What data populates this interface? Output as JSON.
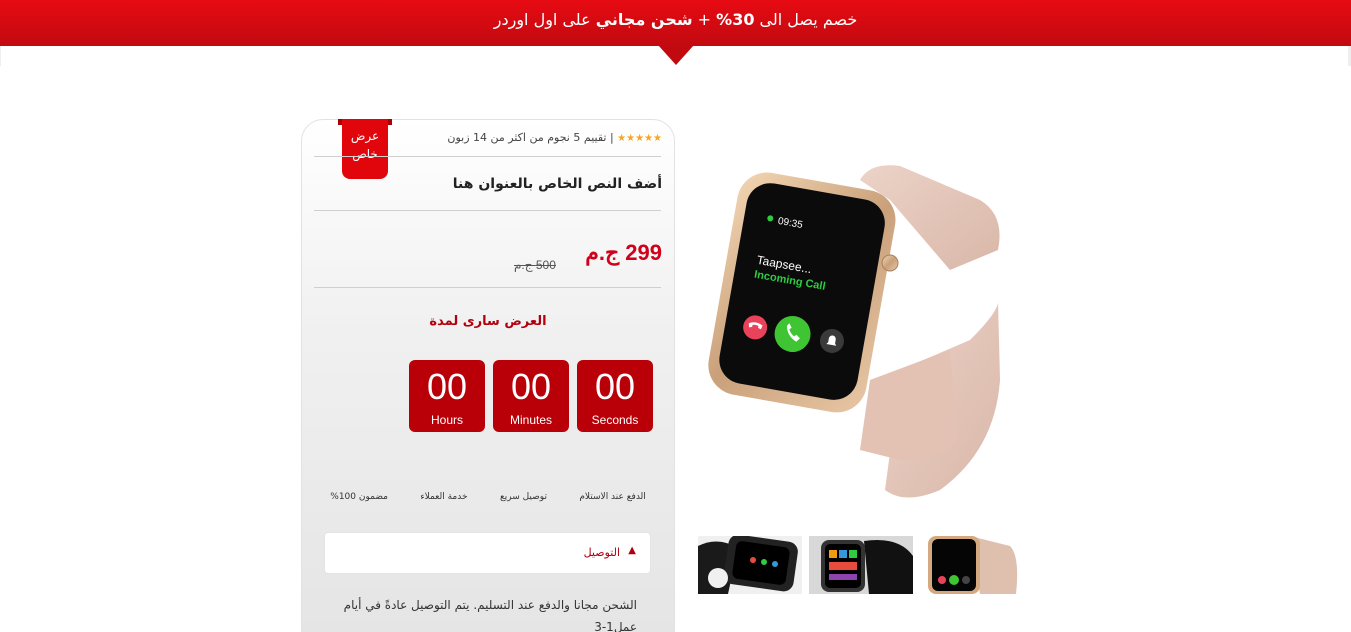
{
  "banner": {
    "text_part1": "خصم يصل الى ",
    "discount": "30%",
    "text_plus": " + ",
    "shipping": "شحن مجاني",
    "text_part2": " على اول اوردر"
  },
  "product": {
    "badge_line1": "عرض",
    "badge_line2": "خاص",
    "stars": "★★★★★",
    "rating_text": "| تقييم 5 نجوم من اكثر من 14 زبون",
    "title": "أضف النص الخاص بالعنوان هنا",
    "price_now": "299 ج.م",
    "price_old": "500 ج.م",
    "offer_label": "العرض سارى لمدة"
  },
  "timer": {
    "seconds": {
      "value": "00",
      "label": "Seconds"
    },
    "minutes": {
      "value": "00",
      "label": "Minutes"
    },
    "hours": {
      "value": "00",
      "label": "Hours"
    }
  },
  "features": [
    "الدفع عند الاستلام",
    "توصيل سريع",
    "خدمة العملاء",
    "مضمون 100%"
  ],
  "accordion": {
    "title": "التوصيل",
    "content": "الشحن مجانا والدفع عند التسليم.  يتم التوصيل عادةً في أيام عمل1-3"
  },
  "watch_screen": {
    "time": "09:35",
    "caller": "Taapsee...",
    "status": "Incoming Call"
  },
  "colors": {
    "accent": "#e0060c",
    "timer_bg": "#b90008",
    "price": "#d0021b"
  }
}
